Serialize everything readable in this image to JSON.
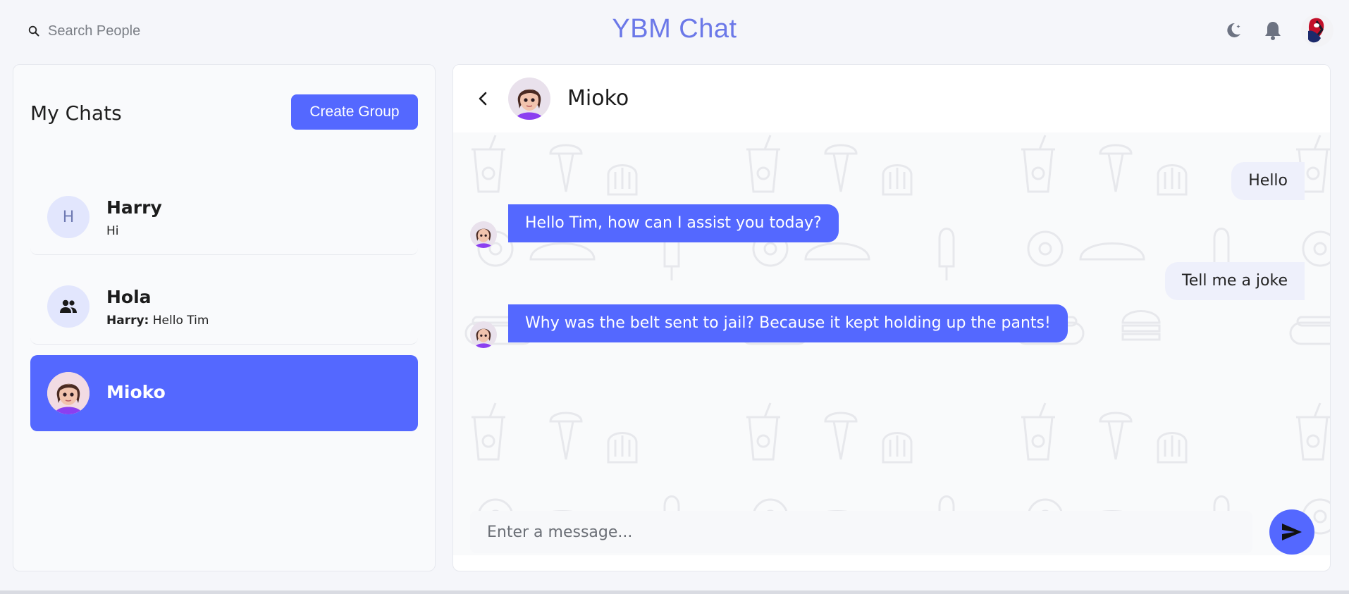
{
  "header": {
    "search_placeholder": "Search People",
    "app_title": "YBM Chat",
    "icons": [
      "search-icon",
      "moon-icon",
      "bell-icon",
      "avatar"
    ]
  },
  "sidebar": {
    "title": "My Chats",
    "create_group_label": "Create Group",
    "chats": [
      {
        "name": "Harry",
        "initial": "H",
        "preview": "Hi",
        "sender": ""
      },
      {
        "name": "Hola",
        "initial": "",
        "preview": "Hello Tim",
        "sender": "Harry:"
      },
      {
        "name": "Mioko",
        "initial": "",
        "preview": "",
        "sender": "",
        "active": true
      }
    ]
  },
  "chat": {
    "contact_name": "Mioko",
    "messages": [
      {
        "from": "me",
        "text": "Hello"
      },
      {
        "from": "Mioko",
        "text": "Hello Tim, how can I assist you today?"
      },
      {
        "from": "me",
        "text": "Tell me a joke"
      },
      {
        "from": "Mioko",
        "text": "Why was the belt sent to jail? Because it kept holding up the pants!"
      }
    ],
    "composer_placeholder": "Enter a message..."
  },
  "colors": {
    "accent": "#5468ff",
    "title": "#6b78e8",
    "outgoing_bubble": "#eef0fb",
    "background": "#f5f6fa"
  }
}
